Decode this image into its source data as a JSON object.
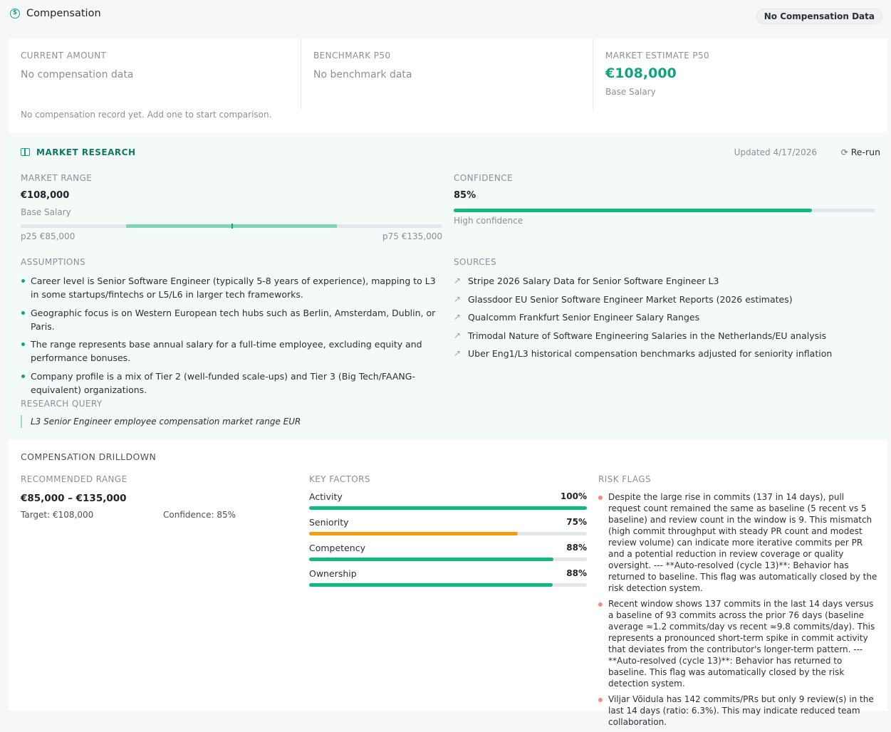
{
  "header": {
    "title": "Compensation",
    "badge": "No Compensation Data",
    "icon": "dollar-circle-icon"
  },
  "summary": {
    "current": {
      "label": "CURRENT AMOUNT",
      "value": "No compensation data"
    },
    "benchmark": {
      "label": "BENCHMARK P50",
      "value": "No benchmark data"
    },
    "estimate": {
      "label": "MARKET ESTIMATE P50",
      "value": "€108,000",
      "sub": "Base Salary"
    },
    "note": "No compensation record yet. Add one to start comparison."
  },
  "research": {
    "title": "MARKET RESEARCH",
    "updated": "Updated 4/17/2026",
    "rerun": "Re-run",
    "market_range": {
      "label": "MARKET RANGE",
      "value": "€108,000",
      "sub": "Base Salary",
      "p25": "p25 €85,000",
      "p75": "p75 €135,000",
      "fill_start": 0.25,
      "fill_end": 0.75,
      "marker": 0.5
    },
    "confidence": {
      "label": "CONFIDENCE",
      "value": "85%",
      "sub": "High confidence",
      "fraction": 0.85
    },
    "assumptions_label": "ASSUMPTIONS",
    "assumptions": [
      "Career level is Senior Software Engineer (typically 5-8 years of experience), mapping to L3 in some startups/fintechs or L5/L6 in larger tech frameworks.",
      "Geographic focus is on Western European tech hubs such as Berlin, Amsterdam, Dublin, or Paris.",
      "The range represents base annual salary for a full-time employee, excluding equity and performance bonuses.",
      "Company profile is a mix of Tier 2 (well-funded scale-ups) and Tier 3 (Big Tech/FAANG-equivalent) organizations."
    ],
    "sources_label": "SOURCES",
    "sources": [
      "Stripe 2026 Salary Data for Senior Software Engineer L3",
      "Glassdoor EU Senior Software Engineer Market Reports (2026 estimates)",
      "Qualcomm Frankfurt Senior Engineer Salary Ranges",
      "Trimodal Nature of Software Engineering Salaries in the Netherlands/EU analysis",
      "Uber Eng1/L3 historical compensation benchmarks adjusted for seniority inflation"
    ],
    "query_label": "RESEARCH QUERY",
    "query": "L3 Senior Engineer employee compensation market range EUR"
  },
  "drilldown": {
    "title": "COMPENSATION DRILLDOWN",
    "recommended": {
      "label": "RECOMMENDED RANGE",
      "value": "€85,000 – €135,000",
      "target": "Target: €108,000",
      "confidence": "Confidence: 85%"
    },
    "factors_label": "KEY FACTORS",
    "factors": [
      {
        "name": "Activity",
        "percent": "100%",
        "fraction": 1.0,
        "color": "#10b981"
      },
      {
        "name": "Seniority",
        "percent": "75%",
        "fraction": 0.75,
        "color": "#f59e0b"
      },
      {
        "name": "Competency",
        "percent": "88%",
        "fraction": 0.88,
        "color": "#10b981"
      },
      {
        "name": "Ownership",
        "percent": "88%",
        "fraction": 0.878,
        "color": "#10b981"
      }
    ],
    "risk_label": "RISK FLAGS",
    "risks": [
      "Despite the large rise in commits (137 in 14 days), pull request count remained the same as baseline (5 recent vs 5 baseline) and review count in the window is 9. This mismatch (high commit throughput with steady PR count and modest review volume) can indicate more iterative commits per PR and a potential reduction in review coverage or quality oversight. --- **Auto-resolved (cycle 13)**: Behavior has returned to baseline. This flag was automatically closed by the risk detection system.",
      "Recent window shows 137 commits in the last 14 days versus a baseline of 93 commits across the prior 76 days (baseline average ≈1.2 commits/day vs recent ≈9.8 commits/day). This represents a pronounced short-term spike in commit activity that deviates from the contributor's longer-term pattern. --- **Auto-resolved (cycle 13)**: Behavior has returned to baseline. This flag was automatically closed by the risk detection system.",
      "Viljar Võidula has 142 commits/PRs but only 9 review(s) in the last 14 days (ratio: 6.3%). This may indicate reduced team collaboration."
    ]
  }
}
